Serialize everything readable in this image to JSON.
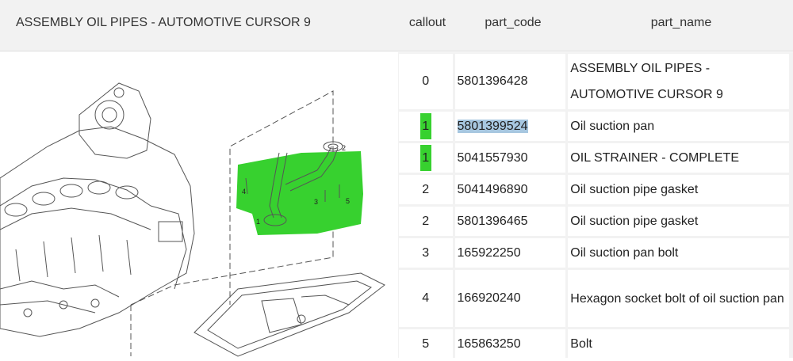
{
  "header": {
    "title": "ASSEMBLY OIL PIPES - AUTOMOTIVE CURSOR 9",
    "columns": [
      "callout",
      "part_code",
      "part_name"
    ]
  },
  "diagram": {
    "callout_labels": [
      "1",
      "2",
      "3",
      "4",
      "5"
    ],
    "highlight_color": "#37d12f"
  },
  "rows": [
    {
      "callout": "0",
      "part_code": "5801396428",
      "part_name": "ASSEMBLY OIL PIPES - AUTOMOTIVE CURSOR 9",
      "highlighted": false
    },
    {
      "callout": "1",
      "part_code": "5801399524",
      "part_name": "Oil suction pan",
      "highlighted": true,
      "code_selected": true
    },
    {
      "callout": "1",
      "part_code": "5041557930",
      "part_name": "OIL STRAINER - COMPLETE",
      "highlighted": true
    },
    {
      "callout": "2",
      "part_code": "5041496890",
      "part_name": "Oil suction pipe gasket",
      "highlighted": false
    },
    {
      "callout": "2",
      "part_code": "5801396465",
      "part_name": "Oil suction pipe gasket",
      "highlighted": false
    },
    {
      "callout": "3",
      "part_code": "165922250",
      "part_name": "Oil suction pan bolt",
      "highlighted": false
    },
    {
      "callout": "4",
      "part_code": "166920240",
      "part_name": "Hexagon socket bolt of oil suction pan",
      "highlighted": false
    },
    {
      "callout": "5",
      "part_code": "165863250",
      "part_name": "Bolt",
      "highlighted": false
    }
  ]
}
